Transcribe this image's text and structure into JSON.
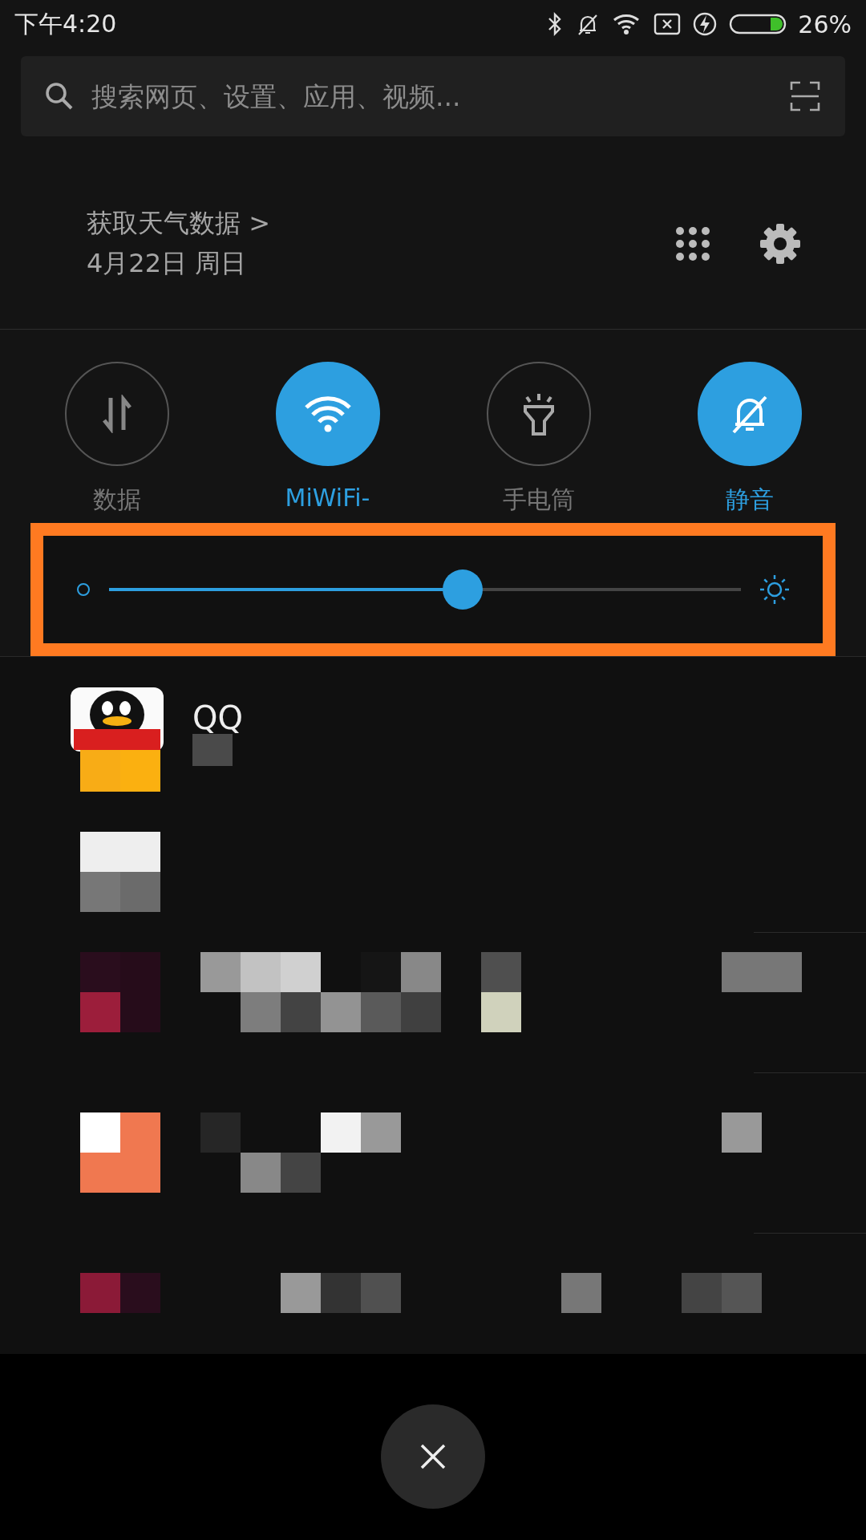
{
  "status_bar": {
    "time": "下午4:20",
    "battery_percent": "26%"
  },
  "search": {
    "placeholder": "搜索网页、设置、应用、视频..."
  },
  "header": {
    "weather_link": "获取天气数据 >",
    "date": "4月22日 周日"
  },
  "toggles": [
    {
      "kind": "data",
      "label": "数据",
      "on": false
    },
    {
      "kind": "wifi",
      "label": "MiWiFi-",
      "on": true
    },
    {
      "kind": "flashlight",
      "label": "手电筒",
      "on": false
    },
    {
      "kind": "silent",
      "label": "静音",
      "on": true
    }
  ],
  "brightness": {
    "level": 0.56
  },
  "notifications": [
    {
      "kind": "app",
      "app_name": "QQ"
    },
    {
      "kind": "picture"
    },
    {
      "kind": "picture"
    },
    {
      "kind": "picture"
    },
    {
      "kind": "picture"
    }
  ]
}
